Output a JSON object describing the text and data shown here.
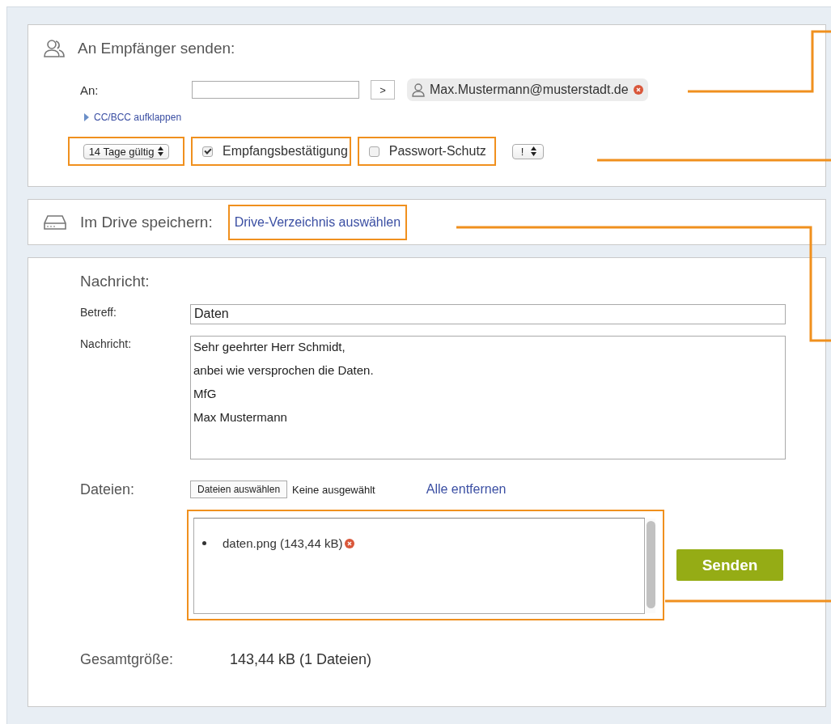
{
  "recipients": {
    "title": "An Empfänger senden:",
    "to_label": "An:",
    "add_button": ">",
    "chips": [
      {
        "email": "Max.Mustermann@musterstadt.de"
      }
    ],
    "cc_toggle": "CC/BCC aufklappen",
    "validity": "14 Tage gültig",
    "options": [
      {
        "label": "Empfangsbestätigung",
        "checked": true
      },
      {
        "label": "Passwort-Schutz",
        "checked": false
      }
    ],
    "priority": "!"
  },
  "drive": {
    "title": "Im Drive speichern:",
    "link": "Drive-Verzeichnis auswählen"
  },
  "message": {
    "heading": "Nachricht:",
    "subject_label": "Betreff:",
    "subject": "Daten",
    "body_label": "Nachricht:",
    "body_lines": [
      "Sehr geehrter Herr Schmidt,",
      "anbei wie versprochen die Daten.",
      "MfG",
      "Max Mustermann"
    ],
    "files_label": "Dateien:",
    "choose_button": "Dateien auswählen",
    "no_file": "Keine ausgewählt",
    "remove_all": "Alle entfernen",
    "files": [
      {
        "name": "daten.png (143,44 kB)"
      }
    ],
    "send": "Senden",
    "total_label": "Gesamtgröße:",
    "total": "143,44 kB (1 Dateien)"
  }
}
